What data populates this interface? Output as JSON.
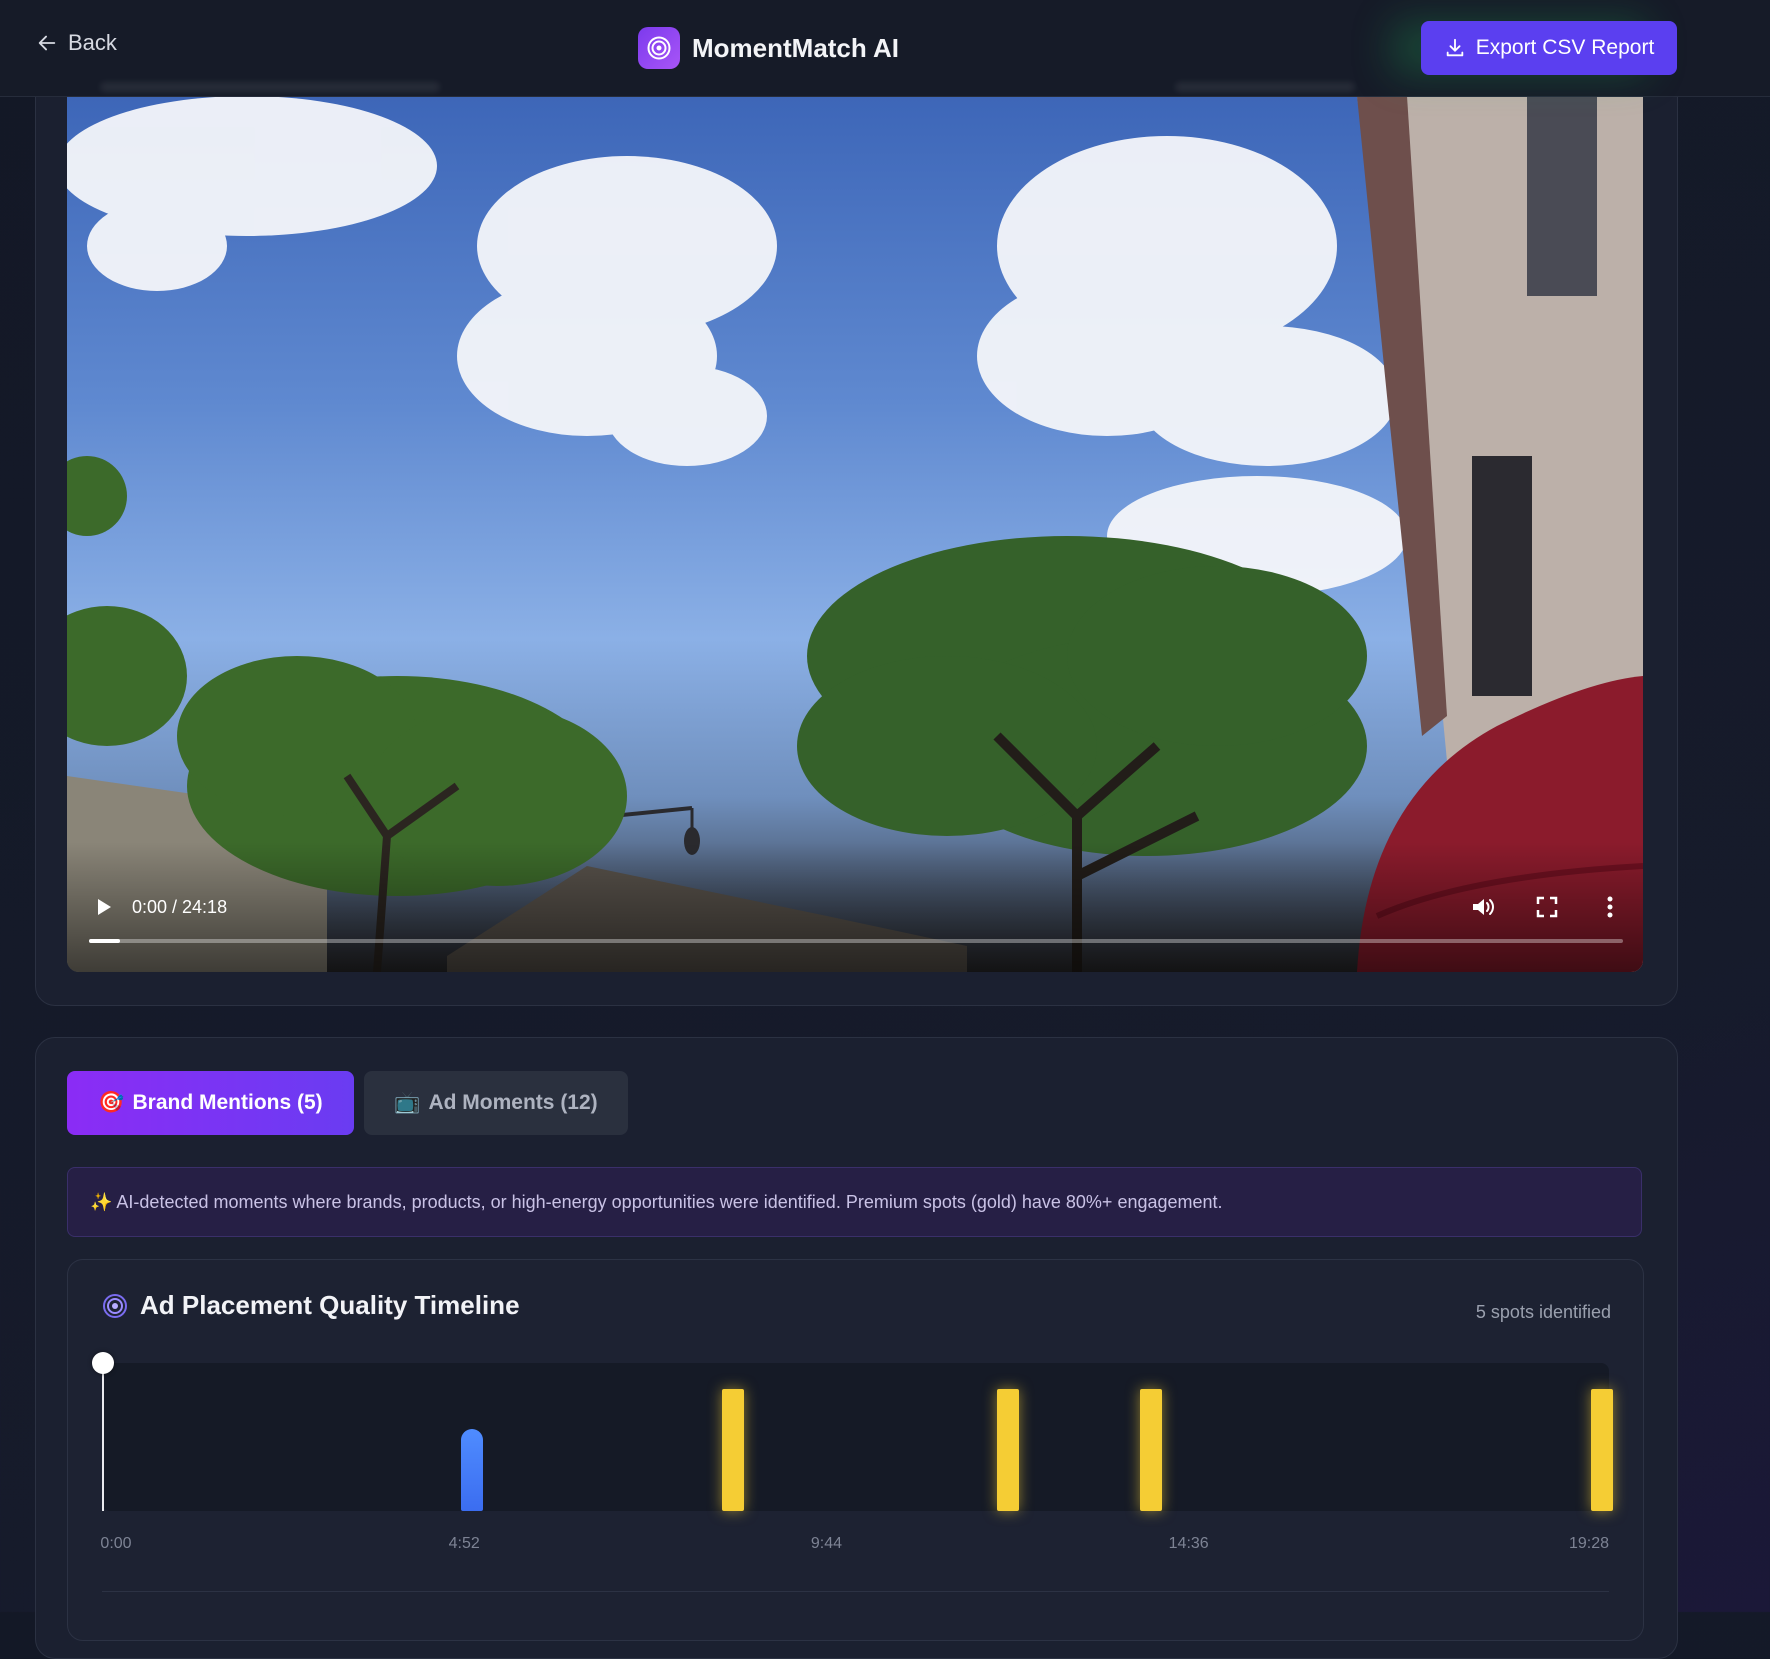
{
  "header": {
    "back_label": "Back",
    "app_name": "MomentMatch AI",
    "export_label": "Export CSV Report"
  },
  "video": {
    "timecode": "0:00 / 24:18",
    "progress": 0.02
  },
  "tabs": [
    {
      "icon": "🎯",
      "label": "Brand Mentions (5)",
      "active": true
    },
    {
      "icon": "📺",
      "label": "Ad Moments (12)",
      "active": false
    }
  ],
  "info_text": "✨ AI-detected moments where brands, products, or high-energy opportunities were identified. Premium spots (gold) have 80%+ engagement.",
  "timeline": {
    "title": "Ad Placement Quality Timeline",
    "spots_label": "5 spots identified",
    "duration_seconds": 1458,
    "playhead_seconds": 0,
    "ticks": [
      {
        "label": "0:00",
        "seconds": 0
      },
      {
        "label": "4:52",
        "seconds": 292
      },
      {
        "label": "9:44",
        "seconds": 584
      },
      {
        "label": "14:36",
        "seconds": 876
      },
      {
        "label": "19:28",
        "seconds": 1168
      }
    ],
    "spots": [
      {
        "seconds": 298,
        "tier": "standard",
        "color": "#4f8cff",
        "score": 0.55
      },
      {
        "seconds": 509,
        "tier": "premium",
        "color": "#f5cd34",
        "score": 0.85
      },
      {
        "seconds": 730,
        "tier": "premium",
        "color": "#f5cd34",
        "score": 0.85
      },
      {
        "seconds": 846,
        "tier": "premium",
        "color": "#f5cd34",
        "score": 0.85
      },
      {
        "seconds": 1209,
        "tier": "premium",
        "color": "#f5cd34",
        "score": 0.85
      }
    ]
  },
  "colors": {
    "accent": "#5b3ff0",
    "premium": "#f5cd34",
    "standard": "#4f8cff"
  }
}
